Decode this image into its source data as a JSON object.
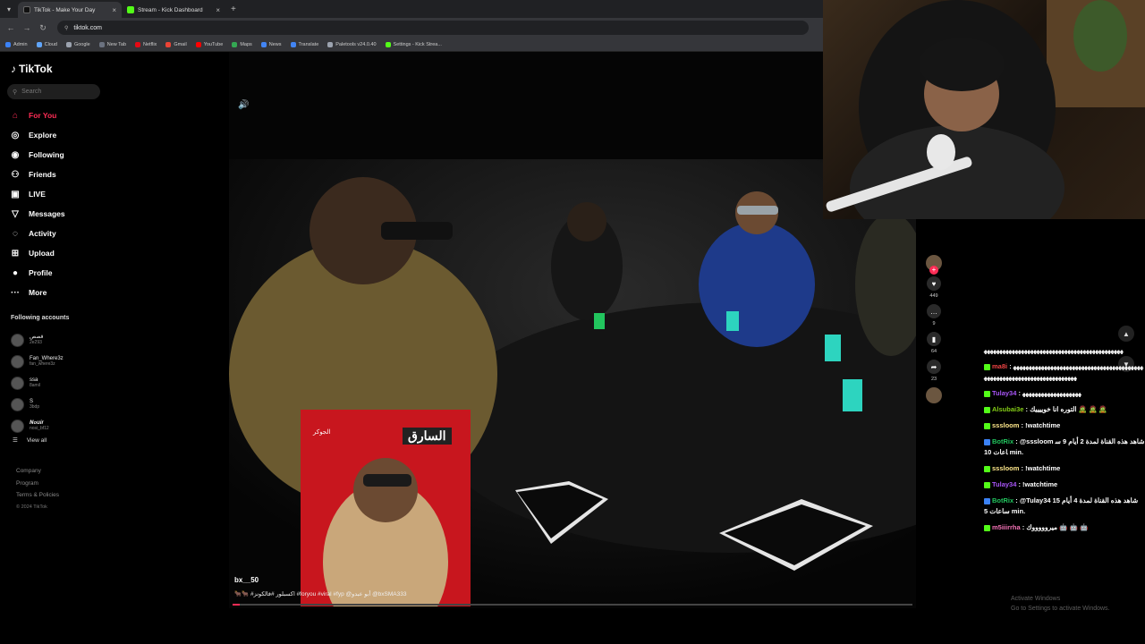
{
  "browser": {
    "tabs": [
      {
        "title": "TikTok - Make Your Day",
        "active": true,
        "favicon_color": "#ffffff"
      },
      {
        "title": "Stream - Kick Dashboard",
        "active": false,
        "favicon_color": "#53fc18"
      }
    ],
    "url": "tiktok.com",
    "bookmarks": [
      {
        "label": "Admin",
        "color": "#3b82f6"
      },
      {
        "label": "Cloud",
        "color": "#60a5fa"
      },
      {
        "label": "Google",
        "color": "#9ca3af"
      },
      {
        "label": "New Tab",
        "color": "#6b7280"
      },
      {
        "label": "Netflix",
        "color": "#e50914"
      },
      {
        "label": "Gmail",
        "color": "#ea4335"
      },
      {
        "label": "YouTube",
        "color": "#ff0000"
      },
      {
        "label": "Maps",
        "color": "#34a853"
      },
      {
        "label": "News",
        "color": "#4285f4"
      },
      {
        "label": "Translate",
        "color": "#4285f4"
      },
      {
        "label": "Paletools v24.0.40",
        "color": "#9ca3af"
      },
      {
        "label": "Settings - Kick Strea...",
        "color": "#53fc18"
      }
    ]
  },
  "tiktok": {
    "logo": "TikTok",
    "search_placeholder": "Search",
    "nav": [
      {
        "label": "For You",
        "icon": "home-icon",
        "glyph": "⌂",
        "active": true
      },
      {
        "label": "Explore",
        "icon": "compass-icon",
        "glyph": "◎",
        "active": false
      },
      {
        "label": "Following",
        "icon": "following-icon",
        "glyph": "◉",
        "active": false
      },
      {
        "label": "Friends",
        "icon": "friends-icon",
        "glyph": "⚇",
        "active": false
      },
      {
        "label": "LIVE",
        "icon": "live-icon",
        "glyph": "▣",
        "active": false
      },
      {
        "label": "Messages",
        "icon": "messages-icon",
        "glyph": "▽",
        "active": false
      },
      {
        "label": "Activity",
        "icon": "activity-icon",
        "glyph": "◌",
        "active": false
      },
      {
        "label": "Upload",
        "icon": "upload-icon",
        "glyph": "⊞",
        "active": false
      },
      {
        "label": "Profile",
        "icon": "profile-icon",
        "glyph": "●",
        "active": false
      },
      {
        "label": "More",
        "icon": "more-icon",
        "glyph": "···",
        "active": false
      }
    ],
    "following_header": "Following accounts",
    "accounts": [
      {
        "name": "قصص",
        "handle": "2e293"
      },
      {
        "name": "Fan_Where3z",
        "handle": "fan_where3z"
      },
      {
        "name": "ssa",
        "handle": "8amil"
      },
      {
        "name": "S",
        "handle": "3bdp"
      },
      {
        "name": "𝑵𝒐𝒖𝒊𝒓",
        "handle": "nosi_bf12"
      }
    ],
    "view_all": "View all",
    "footer": [
      "Company",
      "Program",
      "Terms & Policies"
    ],
    "copyright": "© 2024 TikTok",
    "video": {
      "author": "bx__50",
      "caption": "🐂🐂 #اكسبلور #فالكونز #foryou #viral #fyp @أبو عبدو @bxSMA333",
      "progress": 0.01,
      "overlay_title": "السارق",
      "overlay_label": "الجوكر"
    },
    "actions": [
      {
        "icon": "heart-icon",
        "glyph": "♥",
        "count": "449"
      },
      {
        "icon": "comment-icon",
        "glyph": "…",
        "count": "9"
      },
      {
        "icon": "bookmark-icon",
        "glyph": "▮",
        "count": "64"
      },
      {
        "icon": "share-icon",
        "glyph": "➦",
        "count": "23"
      }
    ]
  },
  "chat": {
    "messages": [
      {
        "user": "",
        "text": "ﻬﻬﻬﻬﻬﻬﻬﻬﻬﻬﻬﻬﻬﻬﻬﻬﻬﻬﻬﻬﻬﻬﻬﻬﻬﻬﻬﻬﻬﻬﻬﻬﻬﻬﻬﻬﻬﻬﻬﻬﻬﻬﻬﻬﻬ",
        "color": "#ffffff"
      },
      {
        "user": "ma8i",
        "text": "ﻬﻬﻬﻬﻬﻬﻬﻬﻬﻬﻬﻬﻬﻬﻬﻬﻬﻬﻬﻬﻬﻬﻬﻬﻬﻬﻬﻬﻬﻬﻬﻬﻬﻬﻬﻬﻬﻬﻬﻬﻬﻬﻬﻬﻬﻬﻬﻬﻬﻬﻬﻬﻬﻬﻬﻬﻬﻬﻬﻬﻬﻬﻬﻬﻬﻬﻬﻬﻬﻬﻬﻬ",
        "color": "#ef4444"
      },
      {
        "user": "Tulay34",
        "text": "ﻬﻬﻬﻬﻬﻬﻬﻬﻬﻬﻬﻬﻬﻬﻬﻬﻬﻬﻬ",
        "color": "#a855f7"
      },
      {
        "user": "Alsubai3e",
        "text": "التوره انا خوييييك 🧟 🧟 🧟",
        "color": "#84cc16"
      },
      {
        "user": "sssloom",
        "text": "!watchtime",
        "color": "#fde68a"
      },
      {
        "user": "BotRix",
        "text": "@sssloom شاهد هذه القناة لمدة 2 أيام 9 ساعات 10 min.",
        "color": "#22c55e"
      },
      {
        "user": "sssloom",
        "text": "!watchtime",
        "color": "#fde68a"
      },
      {
        "user": "Tulay34",
        "text": "!watchtime",
        "color": "#a855f7"
      },
      {
        "user": "BotRix",
        "text": "@Tulay34 شاهد هذه القناة لمدة 4 أيام 15 ساعات 5 min.",
        "color": "#22c55e"
      },
      {
        "user": "m5iiirrha",
        "text": "ميروووووك 🤖 🤖 🤖",
        "color": "#f472b6"
      }
    ],
    "watermark_line1": "Activate Windows",
    "watermark_line2": "Go to Settings to activate Windows."
  }
}
